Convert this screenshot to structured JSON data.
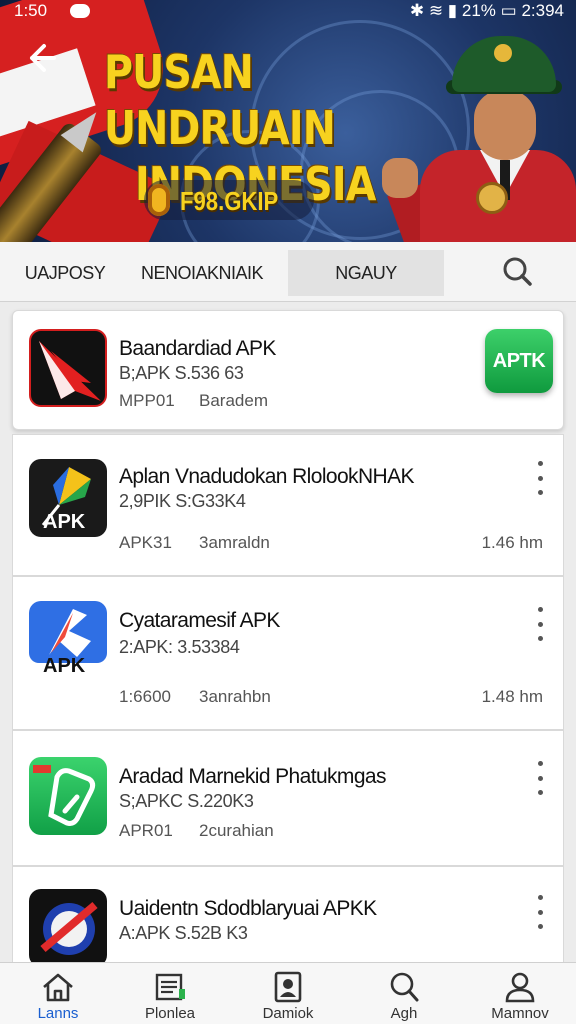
{
  "status_bar": {
    "time_left": "1:50",
    "time_right": "2:394",
    "battery": "21%"
  },
  "banner": {
    "title_line1": "PUSAN UNDRUAIN",
    "title_line2": "INDONESIA",
    "badge_text": "F98.GKIP"
  },
  "tabs": [
    {
      "label": "UAJPOSY"
    },
    {
      "label": "NENOIAKNIAIK"
    },
    {
      "label": "NGAUY"
    }
  ],
  "apps": [
    {
      "title": "Baandardiad APK",
      "subtitle": "B;APK S.536 63",
      "meta1": "MPP01",
      "meta2": "Baradem",
      "size": "",
      "badge": "APTK"
    },
    {
      "title": "Aplan Vnadudokan RlolookNHAK",
      "subtitle": "2,9PIK S:G33K4",
      "meta1": "APK31",
      "meta2": "3amraldn",
      "size": "1.46 hm",
      "icon_text": "APK"
    },
    {
      "title": "Cyataramesif APK",
      "subtitle": "2:APK: 3.53384",
      "meta1": "1:6600",
      "meta2": "3anrahbn",
      "size": "1.48 hm",
      "icon_text": "APK"
    },
    {
      "title": "Aradad Marnekid Phatukmgas",
      "subtitle": "S;APKC S.220K3",
      "meta1": "APR01",
      "meta2": "2curahian",
      "size": ""
    },
    {
      "title": "Uaidentn Sdodblaryuai APKK",
      "subtitle": "A:APK S.52B K3",
      "meta1": "",
      "meta2": "",
      "size": ""
    }
  ],
  "bottom_nav": [
    {
      "label": "Lanns",
      "icon": "home-icon",
      "active": true
    },
    {
      "label": "Plonlea",
      "icon": "list-icon",
      "active": false
    },
    {
      "label": "Damiok",
      "icon": "profile-card-icon",
      "active": false
    },
    {
      "label": "Agh",
      "icon": "search-icon",
      "active": false
    },
    {
      "label": "Mamnov",
      "icon": "user-icon",
      "active": false
    }
  ],
  "colors": {
    "accent": "#1a5fd0",
    "banner_title": "#f7d21f",
    "apk_green": "#14a845",
    "flag_red": "#d62020"
  }
}
